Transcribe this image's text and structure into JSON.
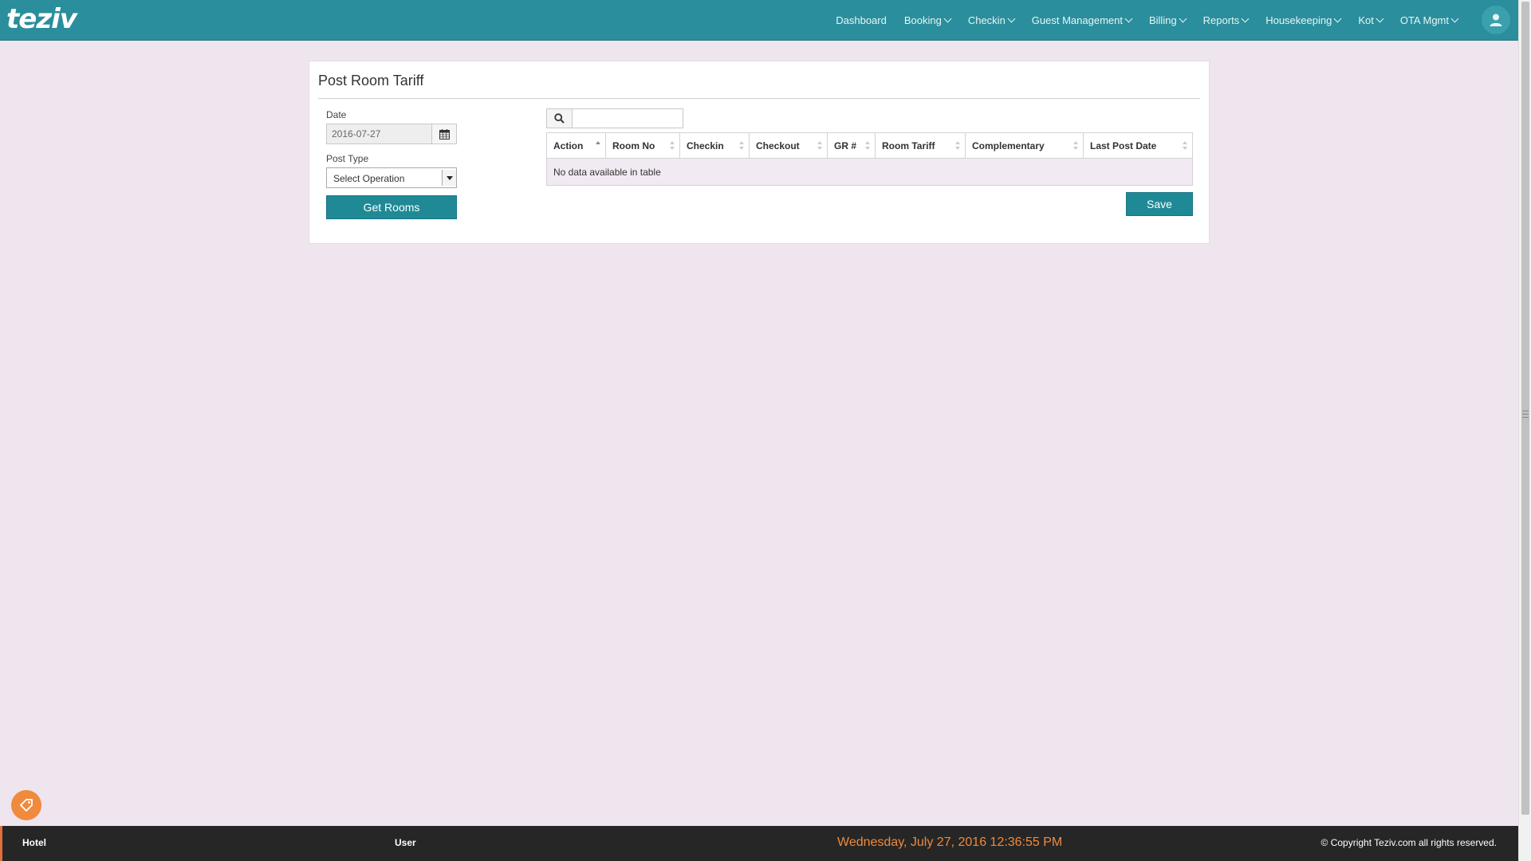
{
  "app": {
    "logo": "teziv"
  },
  "nav": {
    "items": [
      {
        "label": "Dashboard",
        "dropdown": false
      },
      {
        "label": "Booking",
        "dropdown": true
      },
      {
        "label": "Checkin",
        "dropdown": true
      },
      {
        "label": "Guest Management",
        "dropdown": true
      },
      {
        "label": "Billing",
        "dropdown": true
      },
      {
        "label": "Reports",
        "dropdown": true
      },
      {
        "label": "Housekeeping",
        "dropdown": true
      },
      {
        "label": "Kot",
        "dropdown": true
      },
      {
        "label": "OTA Mgmt",
        "dropdown": true
      }
    ],
    "user_icon": "user-icon"
  },
  "panel": {
    "title": "Post Room Tariff",
    "date_label": "Date",
    "date_value": "2016-07-27",
    "calendar_icon": "calendar-icon",
    "post_type_label": "Post Type",
    "post_type_value": "Select Operation",
    "get_rooms_label": "Get Rooms",
    "search_icon": "search-icon",
    "search_value": "",
    "save_label": "Save"
  },
  "table": {
    "columns": [
      "Action",
      "Room No",
      "Checkin",
      "Checkout",
      "GR #",
      "Room Tariff",
      "Complementary",
      "Last Post Date"
    ],
    "sorted_column": "Action",
    "empty_message": "No data available in table"
  },
  "footer": {
    "hotel": "Hotel",
    "user": "User",
    "datetime": "Wednesday, July 27, 2016 12:36:55 PM",
    "copyright": "© Copyright Teziv.com all rights reserved."
  },
  "colors": {
    "topbar": "#2a8e9c",
    "button": "#1f8a96",
    "footer": "#262626",
    "accent": "#f08a3c",
    "background": "#eee5ef"
  }
}
